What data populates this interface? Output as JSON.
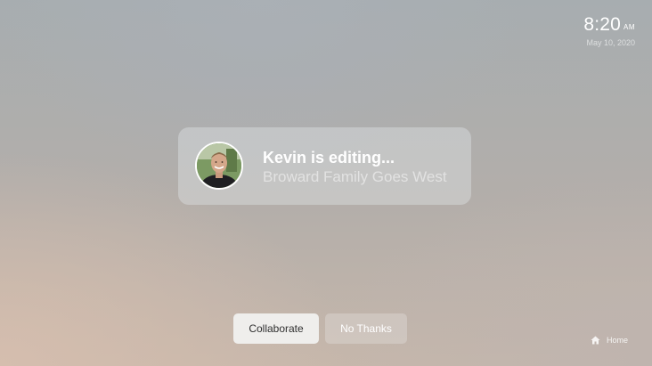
{
  "clock": {
    "time": "8:20",
    "ampm": "AM",
    "date": "May 10, 2020"
  },
  "notification": {
    "title": "Kevin is editing...",
    "subtitle": "Broward Family Goes West"
  },
  "buttons": {
    "collaborate": "Collaborate",
    "no_thanks": "No Thanks"
  },
  "home": {
    "label": "Home",
    "icon": "home-icon"
  }
}
